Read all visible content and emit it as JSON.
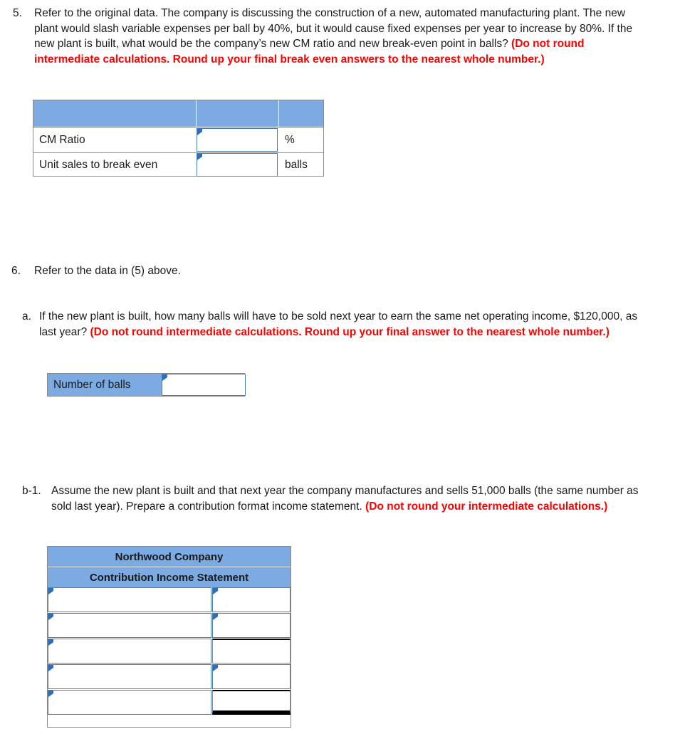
{
  "questions": {
    "q5": {
      "number": "5.",
      "text_part1": "Refer to the original data. The company is discussing the construction of a new, automated manufacturing plant. The new plant would slash variable expenses per ball by 40%, but it would cause fixed expenses per year to increase by 80%. If the new plant is built, what would be the company’s new CM ratio and new break-even point in balls? ",
      "text_red": "(Do not round intermediate calculations. Round up your final break even answers to the nearest whole number.)"
    },
    "q6": {
      "number": "6.",
      "text": "Refer to the data in (5) above."
    },
    "q6a": {
      "number": "a.",
      "text_part1": "If the new plant is built, how many balls will have to be sold next year to earn the same net operating income, $120,000, as last year? ",
      "text_red": "(Do not round intermediate calculations. Round up your final answer to the nearest whole number.)"
    },
    "qb1": {
      "number": "b-1.",
      "text_part1": "Assume the new plant is built and that next year the company manufactures and sells 51,000 balls (the same number as sold last year). Prepare a contribution format income statement. ",
      "text_red": "(Do not round your intermediate calculations.)"
    }
  },
  "table_cm": {
    "header": {
      "col1": "",
      "col2": "",
      "col3": ""
    },
    "rows": [
      {
        "label": "CM Ratio",
        "value": "",
        "unit": "%"
      },
      {
        "label": "Unit sales to break even",
        "value": "",
        "unit": "balls"
      }
    ]
  },
  "balls_answer": {
    "label": "Number of balls",
    "value": ""
  },
  "table_income": {
    "title": "Northwood Company",
    "subtitle": "Contribution Income Statement",
    "rows": [
      {
        "label": "",
        "amount": ""
      },
      {
        "label": "",
        "amount": ""
      },
      {
        "label": "",
        "amount": ""
      },
      {
        "label": "",
        "amount": ""
      },
      {
        "label": "",
        "amount": ""
      }
    ]
  },
  "colors": {
    "header_blue": "#7babe2",
    "dropdown_border": "#4a7ebb",
    "dropdown_triangle": "#2e6fba",
    "red_text": "#ff0000",
    "grid_gray": "#8a8a8a"
  }
}
